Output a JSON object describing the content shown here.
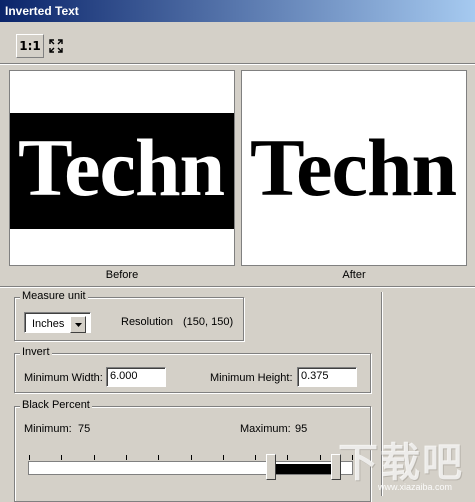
{
  "window": {
    "title": "Inverted Text"
  },
  "toolbar": {
    "actual_size_label": "1:1",
    "fit_icon": "fit-to-window-icon"
  },
  "preview": {
    "sample_text": "Techn",
    "before_caption": "Before",
    "after_caption": "After"
  },
  "measure": {
    "group_label": "Measure unit",
    "unit_value": "Inches",
    "resolution_label": "Resolution",
    "resolution_value": "(150, 150)"
  },
  "invert": {
    "group_label": "Invert",
    "min_width_label": "Minimum Width:",
    "min_width_value": "6.000",
    "min_height_label": "Minimum Height:",
    "min_height_value": "0.375"
  },
  "black_percent": {
    "group_label": "Black Percent",
    "minimum_label": "Minimum:",
    "minimum_value": "75",
    "maximum_label": "Maximum:",
    "maximum_value": "95",
    "slider_min_percent": 75,
    "slider_max_percent": 95
  },
  "watermark": {
    "text": "下载吧",
    "url": "www.xiazaiba.com"
  }
}
